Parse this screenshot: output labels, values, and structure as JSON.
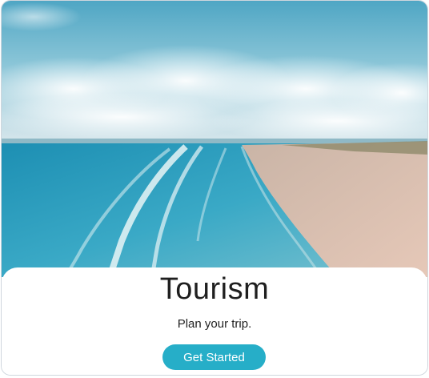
{
  "card": {
    "title": "Tourism",
    "subtitle": "Plan your trip.",
    "cta_label": "Get Started"
  },
  "colors": {
    "accent": "#26aec8",
    "title_text": "#1f1f1f",
    "border": "#cfd6dd"
  }
}
